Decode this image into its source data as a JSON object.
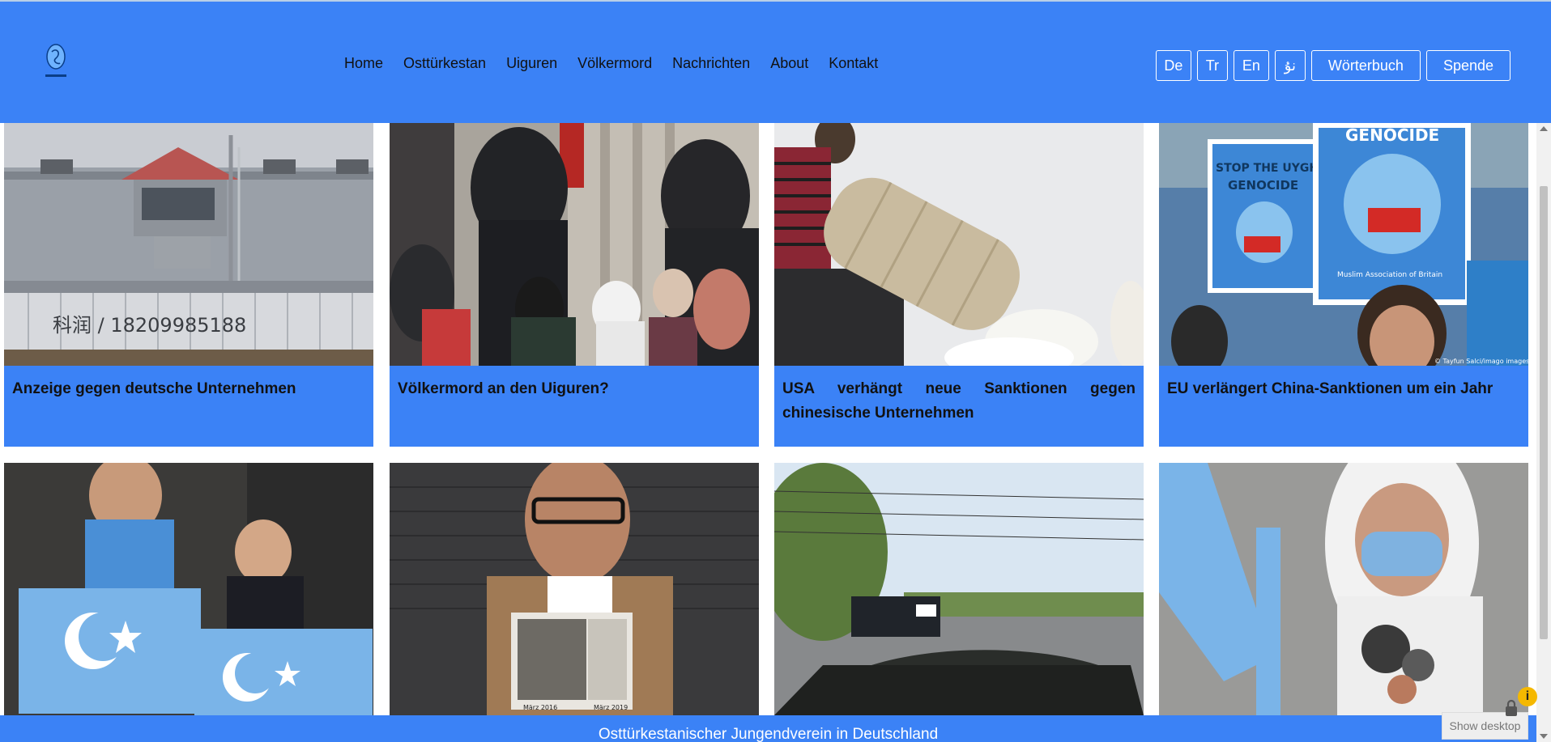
{
  "nav": {
    "items": [
      "Home",
      "Osttürkestan",
      "Uiguren",
      "Völkermord",
      "Nachrichten",
      "About",
      "Kontakt"
    ]
  },
  "lang": {
    "buttons": [
      "De",
      "Tr",
      "En",
      "نۇ"
    ],
    "dictionary": "Wörterbuch",
    "donate": "Spende"
  },
  "articles": [
    {
      "title": "Anzeige gegen deutsche Unternehmen"
    },
    {
      "title": "Völkermord an den Uiguren?"
    },
    {
      "title": "USA verhängt neue Sanktionen gegen chinesische Unternehmen"
    },
    {
      "title": "EU verlängert China-Sanktionen um ein Jahr"
    },
    {
      "title": ""
    },
    {
      "title": ""
    },
    {
      "title": ""
    },
    {
      "title": ""
    }
  ],
  "image_text": {
    "wall_graffiti": "科润 / 18209985188",
    "sign_stop": "STOP THE UYGHUR",
    "sign_genocide": "GENOCIDE",
    "sign_org": "Muslim Association of Britain",
    "photo_credit": "© Tayfun Salci/imago images",
    "photo_date_left": "März 2016",
    "photo_date_right": "März 2019"
  },
  "footer": {
    "text": "Osttürkestanischer Jungendverein in Deutschland",
    "show_desktop": "Show desktop"
  },
  "colors": {
    "brand_blue": "#3b82f6",
    "white": "#ffffff"
  }
}
